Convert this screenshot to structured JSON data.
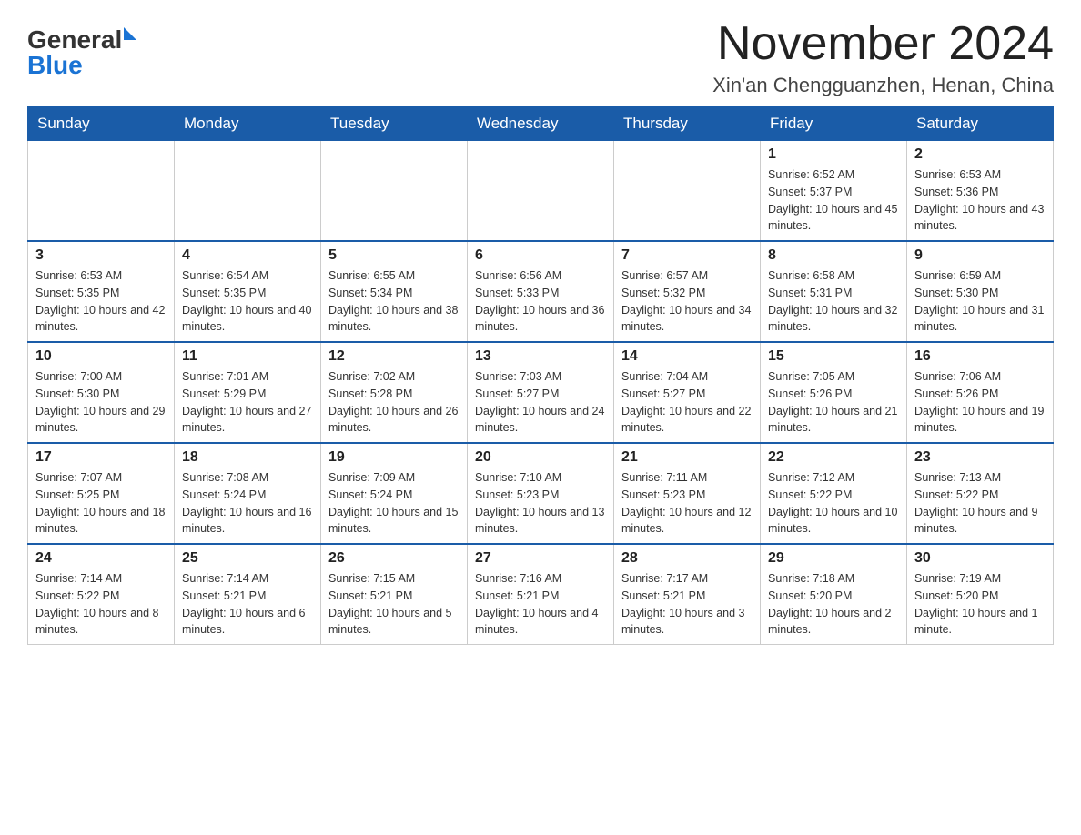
{
  "header": {
    "logo_general": "General",
    "logo_blue": "Blue",
    "month_title": "November 2024",
    "subtitle": "Xin'an Chengguanzhen, Henan, China"
  },
  "weekdays": [
    "Sunday",
    "Monday",
    "Tuesday",
    "Wednesday",
    "Thursday",
    "Friday",
    "Saturday"
  ],
  "weeks": [
    [
      {
        "day": "",
        "info": ""
      },
      {
        "day": "",
        "info": ""
      },
      {
        "day": "",
        "info": ""
      },
      {
        "day": "",
        "info": ""
      },
      {
        "day": "",
        "info": ""
      },
      {
        "day": "1",
        "info": "Sunrise: 6:52 AM\nSunset: 5:37 PM\nDaylight: 10 hours and 45 minutes."
      },
      {
        "day": "2",
        "info": "Sunrise: 6:53 AM\nSunset: 5:36 PM\nDaylight: 10 hours and 43 minutes."
      }
    ],
    [
      {
        "day": "3",
        "info": "Sunrise: 6:53 AM\nSunset: 5:35 PM\nDaylight: 10 hours and 42 minutes."
      },
      {
        "day": "4",
        "info": "Sunrise: 6:54 AM\nSunset: 5:35 PM\nDaylight: 10 hours and 40 minutes."
      },
      {
        "day": "5",
        "info": "Sunrise: 6:55 AM\nSunset: 5:34 PM\nDaylight: 10 hours and 38 minutes."
      },
      {
        "day": "6",
        "info": "Sunrise: 6:56 AM\nSunset: 5:33 PM\nDaylight: 10 hours and 36 minutes."
      },
      {
        "day": "7",
        "info": "Sunrise: 6:57 AM\nSunset: 5:32 PM\nDaylight: 10 hours and 34 minutes."
      },
      {
        "day": "8",
        "info": "Sunrise: 6:58 AM\nSunset: 5:31 PM\nDaylight: 10 hours and 32 minutes."
      },
      {
        "day": "9",
        "info": "Sunrise: 6:59 AM\nSunset: 5:30 PM\nDaylight: 10 hours and 31 minutes."
      }
    ],
    [
      {
        "day": "10",
        "info": "Sunrise: 7:00 AM\nSunset: 5:30 PM\nDaylight: 10 hours and 29 minutes."
      },
      {
        "day": "11",
        "info": "Sunrise: 7:01 AM\nSunset: 5:29 PM\nDaylight: 10 hours and 27 minutes."
      },
      {
        "day": "12",
        "info": "Sunrise: 7:02 AM\nSunset: 5:28 PM\nDaylight: 10 hours and 26 minutes."
      },
      {
        "day": "13",
        "info": "Sunrise: 7:03 AM\nSunset: 5:27 PM\nDaylight: 10 hours and 24 minutes."
      },
      {
        "day": "14",
        "info": "Sunrise: 7:04 AM\nSunset: 5:27 PM\nDaylight: 10 hours and 22 minutes."
      },
      {
        "day": "15",
        "info": "Sunrise: 7:05 AM\nSunset: 5:26 PM\nDaylight: 10 hours and 21 minutes."
      },
      {
        "day": "16",
        "info": "Sunrise: 7:06 AM\nSunset: 5:26 PM\nDaylight: 10 hours and 19 minutes."
      }
    ],
    [
      {
        "day": "17",
        "info": "Sunrise: 7:07 AM\nSunset: 5:25 PM\nDaylight: 10 hours and 18 minutes."
      },
      {
        "day": "18",
        "info": "Sunrise: 7:08 AM\nSunset: 5:24 PM\nDaylight: 10 hours and 16 minutes."
      },
      {
        "day": "19",
        "info": "Sunrise: 7:09 AM\nSunset: 5:24 PM\nDaylight: 10 hours and 15 minutes."
      },
      {
        "day": "20",
        "info": "Sunrise: 7:10 AM\nSunset: 5:23 PM\nDaylight: 10 hours and 13 minutes."
      },
      {
        "day": "21",
        "info": "Sunrise: 7:11 AM\nSunset: 5:23 PM\nDaylight: 10 hours and 12 minutes."
      },
      {
        "day": "22",
        "info": "Sunrise: 7:12 AM\nSunset: 5:22 PM\nDaylight: 10 hours and 10 minutes."
      },
      {
        "day": "23",
        "info": "Sunrise: 7:13 AM\nSunset: 5:22 PM\nDaylight: 10 hours and 9 minutes."
      }
    ],
    [
      {
        "day": "24",
        "info": "Sunrise: 7:14 AM\nSunset: 5:22 PM\nDaylight: 10 hours and 8 minutes."
      },
      {
        "day": "25",
        "info": "Sunrise: 7:14 AM\nSunset: 5:21 PM\nDaylight: 10 hours and 6 minutes."
      },
      {
        "day": "26",
        "info": "Sunrise: 7:15 AM\nSunset: 5:21 PM\nDaylight: 10 hours and 5 minutes."
      },
      {
        "day": "27",
        "info": "Sunrise: 7:16 AM\nSunset: 5:21 PM\nDaylight: 10 hours and 4 minutes."
      },
      {
        "day": "28",
        "info": "Sunrise: 7:17 AM\nSunset: 5:21 PM\nDaylight: 10 hours and 3 minutes."
      },
      {
        "day": "29",
        "info": "Sunrise: 7:18 AM\nSunset: 5:20 PM\nDaylight: 10 hours and 2 minutes."
      },
      {
        "day": "30",
        "info": "Sunrise: 7:19 AM\nSunset: 5:20 PM\nDaylight: 10 hours and 1 minute."
      }
    ]
  ]
}
